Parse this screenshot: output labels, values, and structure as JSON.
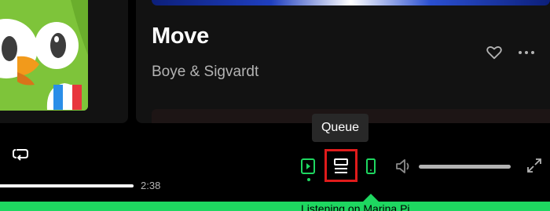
{
  "now_playing": {
    "title": "Move",
    "artist": "Boye & Sigvardt",
    "like_icon": "heart-outline-icon",
    "more_label": "•••"
  },
  "tooltip": {
    "label": "Queue"
  },
  "player": {
    "elapsed": "2:38",
    "repeat_icon": "repeat-icon"
  },
  "controls": {
    "now_playing_view_icon": "now-playing-view-icon",
    "queue_icon": "queue-icon",
    "device_icon": "connect-device-icon",
    "volume_icon": "volume-icon",
    "fullscreen_icon": "fullscreen-icon"
  },
  "banner": {
    "text": "Listening on Marina Pi..."
  },
  "colors": {
    "accent": "#1ed760",
    "background": "#000000",
    "card": "#121212",
    "highlight": "#e01b1b",
    "art_green": "#7ec43a"
  }
}
